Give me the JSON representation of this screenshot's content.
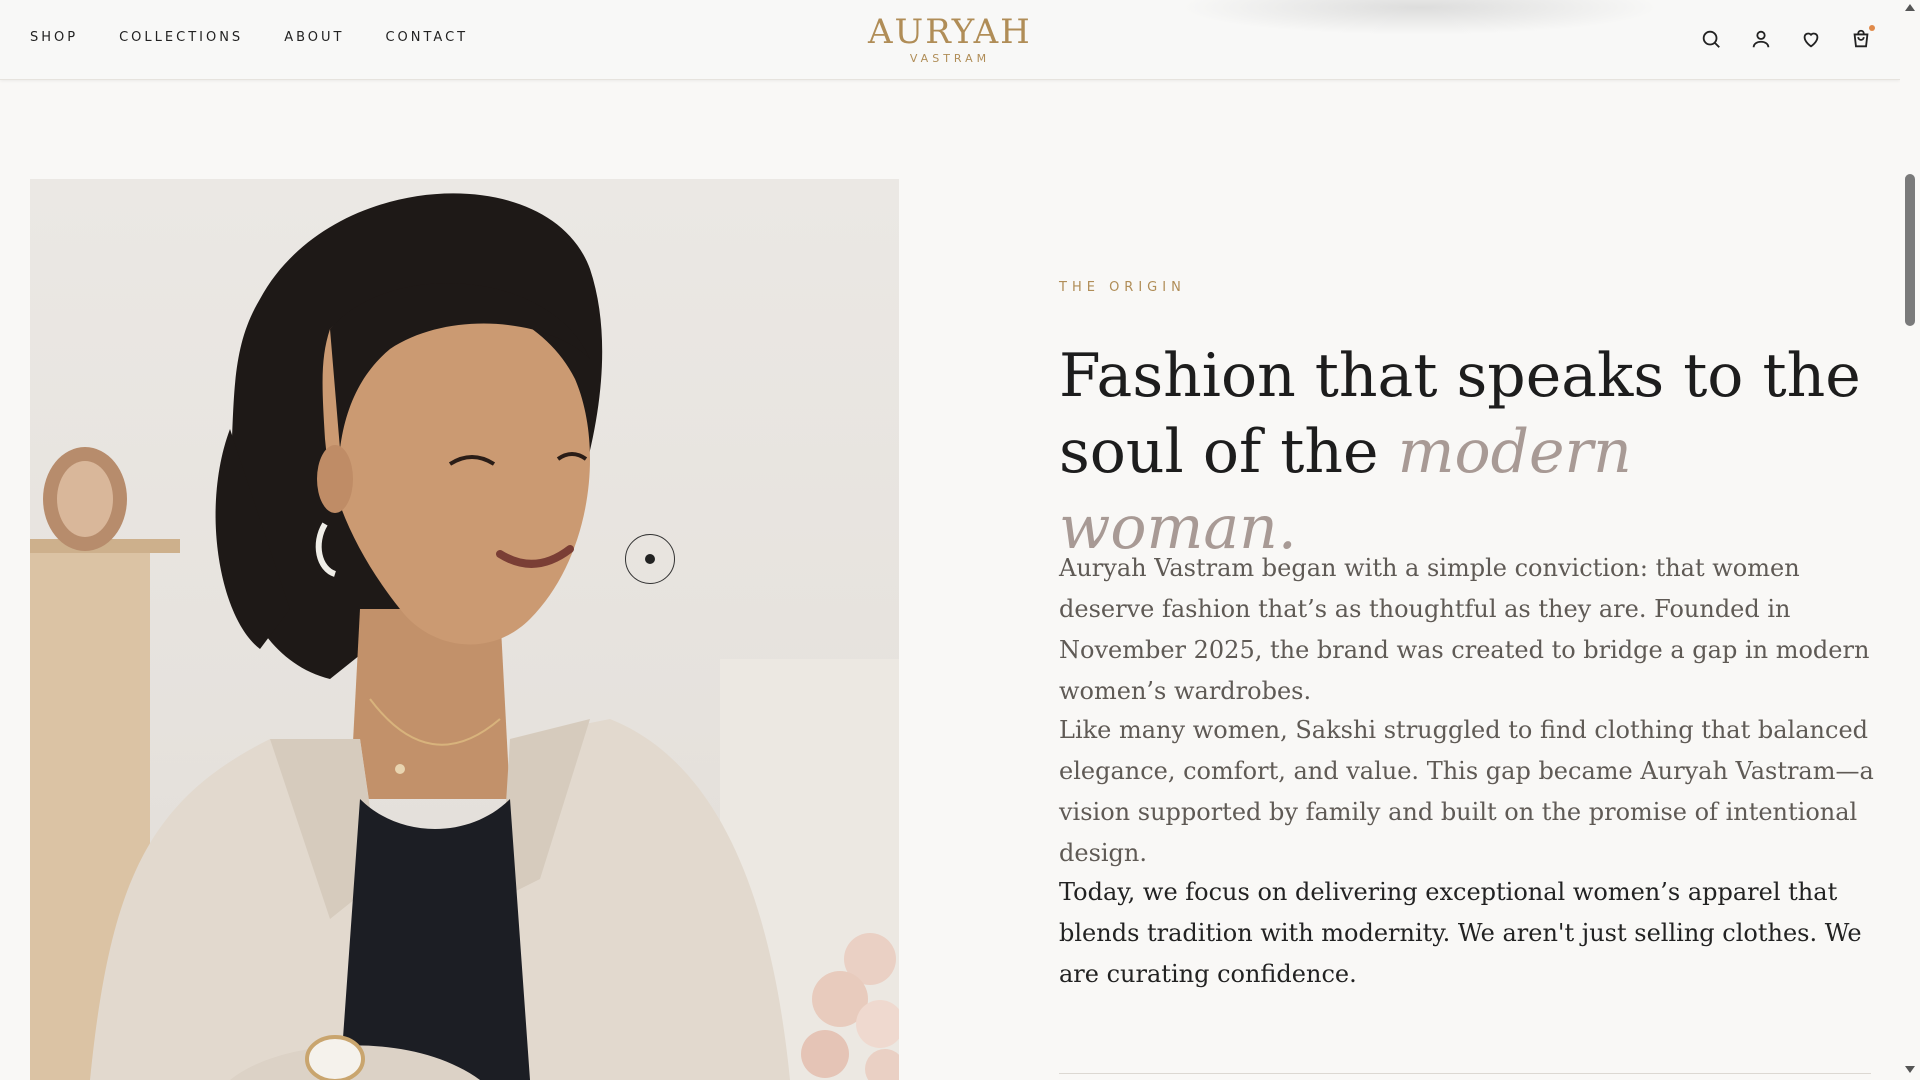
{
  "nav": {
    "items": [
      {
        "label": "SHOP"
      },
      {
        "label": "COLLECTIONS"
      },
      {
        "label": "ABOUT"
      },
      {
        "label": "CONTACT"
      }
    ]
  },
  "logo": {
    "brand": "AURYAH",
    "sub": "VASTRAM"
  },
  "header_icons": [
    "search-icon",
    "user-icon",
    "heart-icon",
    "cart-icon"
  ],
  "colors": {
    "accent": "#b08d57",
    "headline": "#1d1d1d",
    "emphasis": "#a89a95",
    "body": "#5f5a55",
    "background": "#f9f8f6"
  },
  "origin": {
    "eyebrow": "THE ORIGIN",
    "headline_part1": "Fashion that speaks to the soul of the ",
    "headline_emphasis": "modern woman.",
    "paragraphs": [
      "Auryah Vastram began with a simple conviction: that women deserve fashion that’s as thoughtful as they are. Founded in November 2025, the brand was created to bridge a gap in modern women’s wardrobes.",
      "Like many women, Sakshi struggled to find clothing that balanced elegance, comfort, and value. This gap became Auryah Vastram—a vision supported by family and built on the promise of intentional design.",
      "Today, we focus on delivering exceptional women’s apparel that blends tradition with modernity. We aren't just selling clothes. We are curating confidence."
    ]
  }
}
